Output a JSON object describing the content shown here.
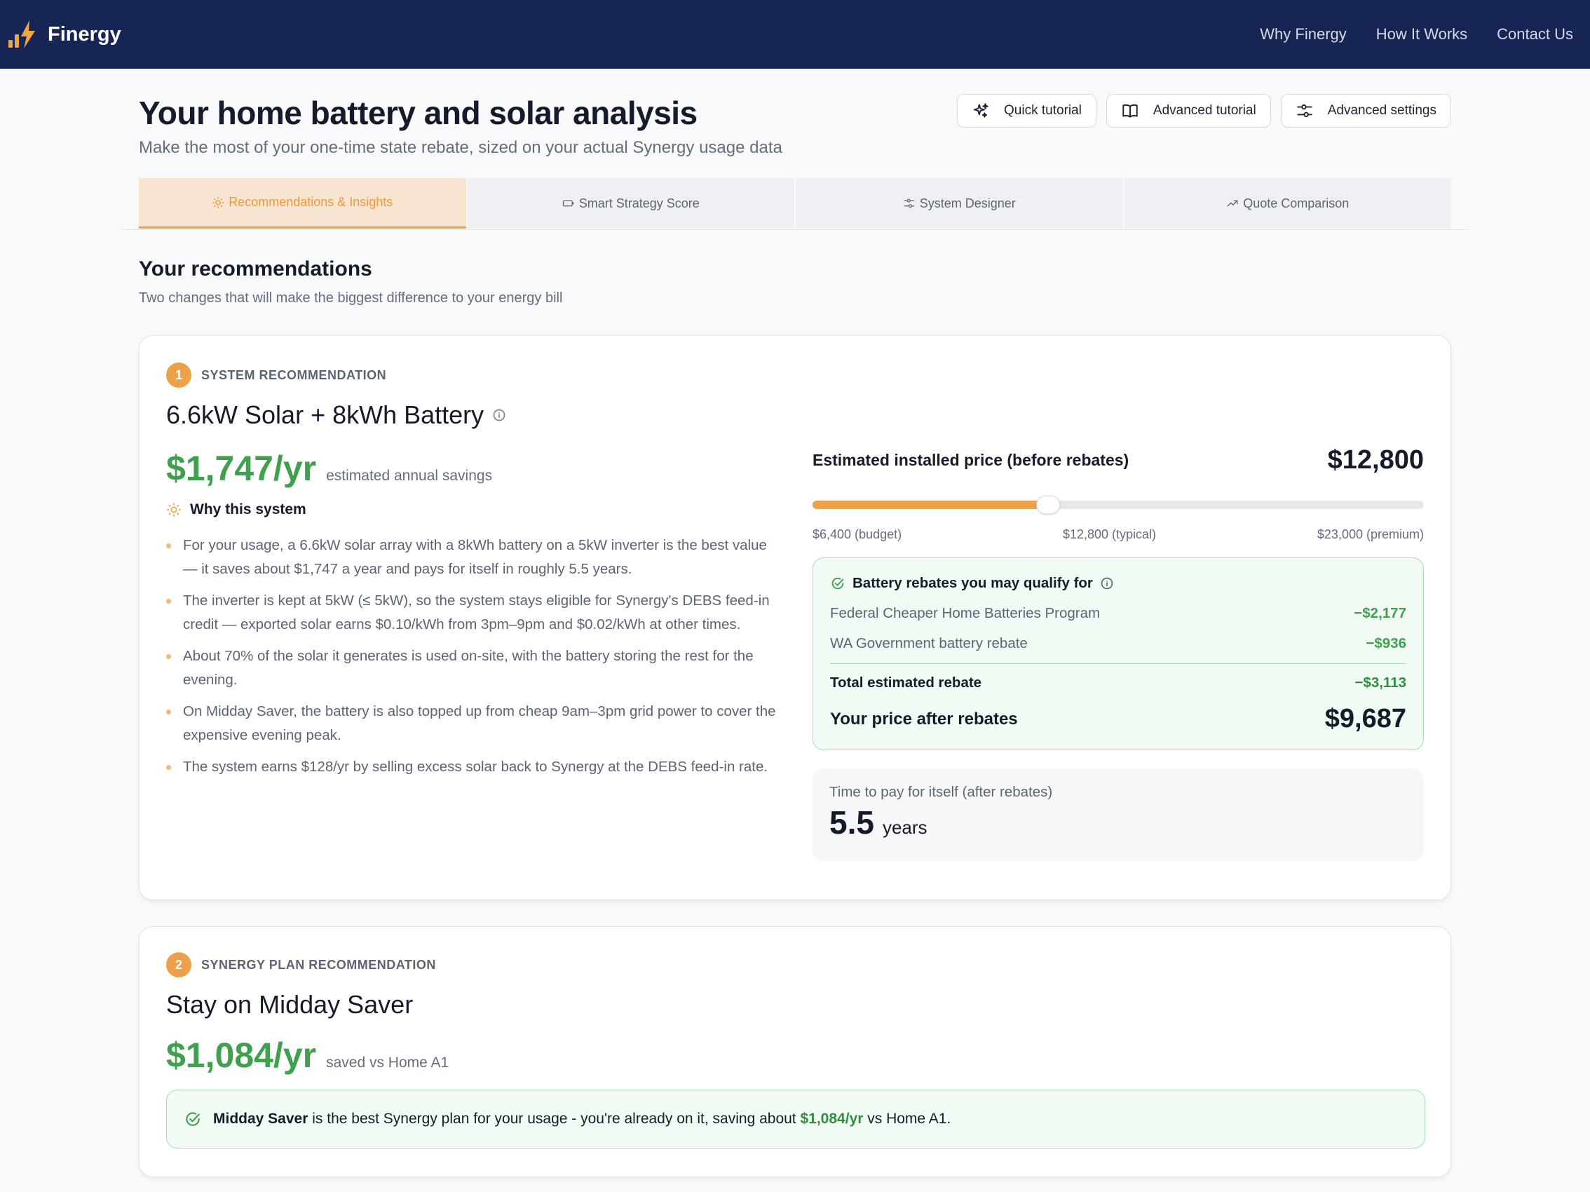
{
  "header": {
    "brand": "Finergy",
    "nav": [
      "Why Finergy",
      "How It Works",
      "Contact Us"
    ]
  },
  "page": {
    "title": "Your home battery and solar analysis",
    "subtitle": "Make the most of your one-time state rebate, sized on your actual Synergy usage data"
  },
  "toolbar": {
    "quick_tutorial": "Quick tutorial",
    "advanced_tutorial": "Advanced tutorial",
    "advanced_settings": "Advanced settings"
  },
  "tabs": [
    {
      "label": "Recommendations & Insights",
      "icon": "sun-icon",
      "active": true
    },
    {
      "label": "Smart Strategy Score",
      "icon": "battery-icon",
      "active": false
    },
    {
      "label": "System Designer",
      "icon": "sliders-icon",
      "active": false
    },
    {
      "label": "Quote Comparison",
      "icon": "trend-up-icon",
      "active": false
    }
  ],
  "recommendations": {
    "title": "Your recommendations",
    "subtitle": "Two changes that will make the biggest difference to your energy bill"
  },
  "system_rec": {
    "number": "1",
    "category": "SYSTEM RECOMMENDATION",
    "title": "6.6kW Solar + 8kWh Battery",
    "savings_value": "$1,747/yr",
    "savings_label": "estimated annual savings",
    "why_title": "Why this system",
    "reasons": [
      "For your usage, a 6.6kW solar array with a 8kWh battery on a 5kW inverter is the best value — it saves about $1,747 a year and pays for itself in roughly 5.5 years.",
      "The inverter is kept at 5kW (≤ 5kW), so the system stays eligible for Synergy's DEBS feed-in credit — exported solar earns $0.10/kWh from 3pm–9pm and $0.02/kWh at other times.",
      "About 70% of the solar it generates is used on-site, with the battery storing the rest for the evening.",
      "On Midday Saver, the battery is also topped up from cheap 9am–3pm grid power to cover the expensive evening peak.",
      "The system earns $128/yr by selling excess solar back to Synergy at the DEBS feed-in rate."
    ],
    "price_label": "Estimated installed price (before rebates)",
    "price_value": "$12,800",
    "slider": {
      "min": 6400,
      "max": 23000,
      "value": 12800,
      "min_label": "$6,400 (budget)",
      "mid_label": "$12,800 (typical)",
      "max_label": "$23,000 (premium)"
    },
    "rebates": {
      "title": "Battery rebates you may qualify for",
      "items": [
        {
          "name": "Federal Cheaper Home Batteries Program",
          "amount": "−$2,177"
        },
        {
          "name": "WA Government battery rebate",
          "amount": "−$936"
        }
      ],
      "total_label": "Total estimated rebate",
      "total_amount": "−$3,113",
      "after_label": "Your price after rebates",
      "after_value": "$9,687"
    },
    "payback": {
      "label": "Time to pay for itself (after rebates)",
      "value": "5.5",
      "unit": "years"
    }
  },
  "plan_rec": {
    "number": "2",
    "category": "SYNERGY PLAN RECOMMENDATION",
    "title": "Stay on Midday Saver",
    "savings_value": "$1,084/yr",
    "savings_label": "saved vs Home A1",
    "note_plan": "Midday Saver",
    "note_middle": " is the best Synergy plan for your usage - you're already on it, saving about ",
    "note_amount": "$1,084/yr",
    "note_end": " vs Home A1."
  },
  "colors": {
    "header_bg": "#172554",
    "accent": "#eda14a",
    "green": "#3fa14e"
  }
}
